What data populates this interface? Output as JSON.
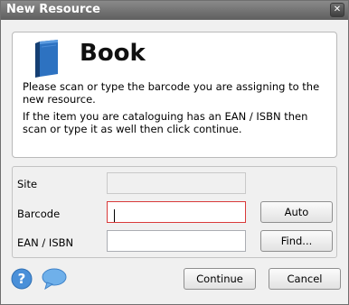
{
  "window": {
    "title": "New Resource",
    "close_glyph": "✕"
  },
  "info": {
    "icon": "book-icon",
    "heading": "Book",
    "line1": "Please scan or type the barcode you are assigning to the new resource.",
    "line2": "If the item you are cataloguing has an EAN / ISBN then scan or type it as well then click continue."
  },
  "form": {
    "site_label": "Site",
    "site_value": "",
    "barcode_label": "Barcode",
    "barcode_value": "",
    "ean_label": "EAN / ISBN",
    "ean_value": "",
    "auto_button": "Auto",
    "find_button": "Find..."
  },
  "footer": {
    "help_icon": "help-icon",
    "chat_icon": "chat-icon",
    "continue_button": "Continue",
    "cancel_button": "Cancel"
  },
  "colors": {
    "titlebar": "#6f6f6f",
    "error_border": "#d93a3a",
    "book_blue": "#1f5fa8"
  }
}
